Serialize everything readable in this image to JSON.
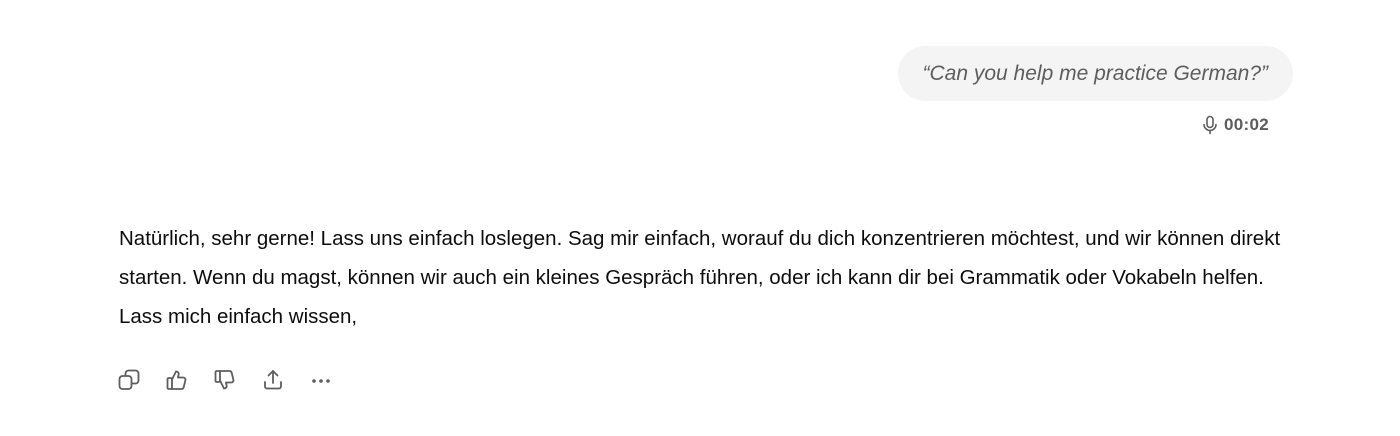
{
  "user_message": {
    "text": "“Can you help me practice German?”",
    "voice_icon": "microphone-icon",
    "duration": "00:02"
  },
  "assistant_message": {
    "text": "Natürlich, sehr gerne! Lass uns einfach loslegen. Sag mir einfach, worauf du dich konzentrieren möchtest, und wir können direkt starten. Wenn du magst, können wir auch ein kleines Gespräch führen, oder ich kann dir bei Grammatik oder Vokabeln helfen. Lass mich einfach wissen,"
  },
  "action_bar": {
    "icons": [
      "copy-icon",
      "thumbs-up-icon",
      "thumbs-down-icon",
      "share-icon",
      "more-icon"
    ]
  },
  "colors": {
    "bubble_bg": "#f4f4f4",
    "muted_text": "#5d5d5d",
    "body_text": "#0d0d0d"
  }
}
